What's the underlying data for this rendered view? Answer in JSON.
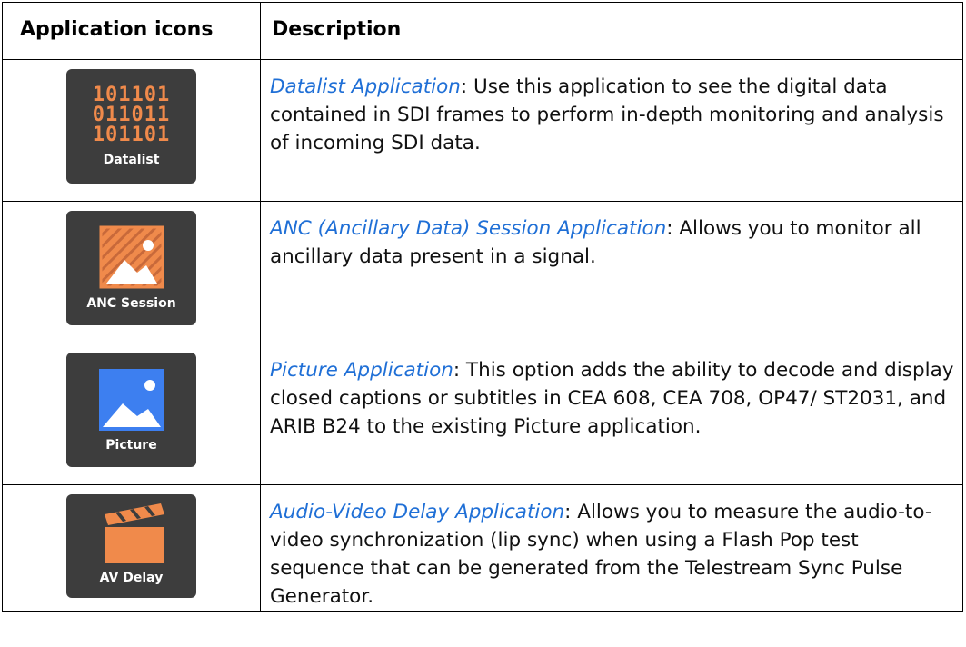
{
  "table": {
    "headers": [
      "Application icons",
      "Description"
    ],
    "rows": [
      {
        "icon_label": "Datalist",
        "icon_binary": [
          "101101",
          "011011",
          "101101"
        ],
        "link": "Datalist Application",
        "text": ": Use this application to see the digital data contained in SDI frames to perform in-depth monitoring and analysis of incoming SDI data."
      },
      {
        "icon_label": "ANC Session",
        "link": "ANC (Ancillary Data) Session Application",
        "text": ": Allows you to monitor all ancillary data present in a signal."
      },
      {
        "icon_label": "Picture",
        "link": "Picture Application",
        "text": ": This option adds the ability to decode and display closed captions or subtitles in CEA 608, CEA 708, OP47/ ST2031, and ARIB B24 to the existing Picture application."
      },
      {
        "icon_label": "AV Delay",
        "link": "Audio-Video Delay Application",
        "text": ": Allows you to measure the audio-to-video synchronization (lip sync) when using a Flash Pop test sequence that can be generated from the Telestream Sync Pulse Generator."
      }
    ]
  },
  "colors": {
    "link": "#1f6fd6",
    "icon_bg": "#3d3d3d",
    "orange": "#f08a4b",
    "blue": "#3d7ff0"
  }
}
